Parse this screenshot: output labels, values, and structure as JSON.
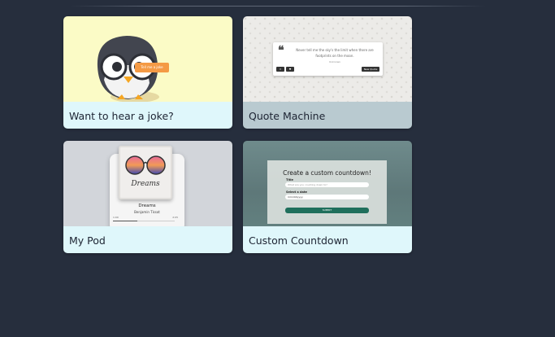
{
  "projects": [
    {
      "title": "Want to hear a joke?",
      "tag_text": "Tell me a joke"
    },
    {
      "title": "Quote Machine",
      "quote_text": "Never tell me the sky's the limit when there are footprints on the moon.",
      "quote_author": "Unknown",
      "new_quote_label": "New Quote"
    },
    {
      "title": "My Pod",
      "album_text": "Dreams",
      "song": "Dreams",
      "artist": "Benjamin Tissot",
      "time_elapsed": "1:00",
      "time_total": "2:05",
      "progress": 0.4
    },
    {
      "title": "Custom Countdown",
      "heading": "Create a custom countdown!",
      "title_label": "Title",
      "title_placeholder": "What are you counting down to?",
      "date_label": "Select a date",
      "date_value": "mm/dd/yyyy",
      "submit_label": "SUBMIT"
    }
  ],
  "colors": {
    "background": "#262e3d",
    "caption_light": "#dff7fb",
    "caption_grey": "#b9cad0"
  }
}
